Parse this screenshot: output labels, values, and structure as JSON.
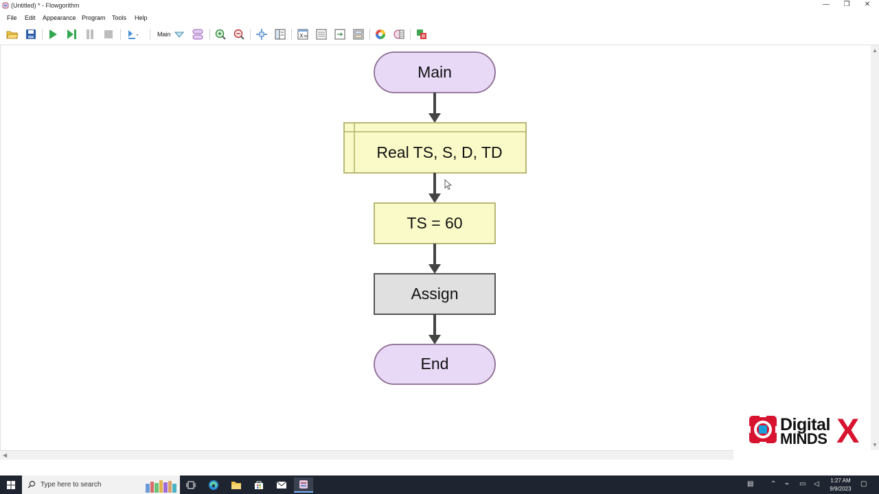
{
  "window": {
    "title": "(Untitled) * - Flowgorithm",
    "minimize_glyph": "—",
    "restore_glyph": "❐",
    "close_glyph": "✕"
  },
  "menu": {
    "items": [
      "File",
      "Edit",
      "Appearance",
      "Program",
      "Tools",
      "Help"
    ]
  },
  "toolbar": {
    "function_label": "Main",
    "icons": [
      "open-folder-icon",
      "save-icon",
      "run-icon",
      "step-icon",
      "pause-icon",
      "stop-icon",
      "run-speed-icon",
      "function-dropdown-icon",
      "manage-functions-icon",
      "zoom-in-icon",
      "zoom-out-icon",
      "layout-icon",
      "variable-watch-icon",
      "console-icon",
      "source-code-icon",
      "chart-icon",
      "color-icon",
      "style-icon",
      "language-icon"
    ]
  },
  "flowchart": {
    "start_label": "Main",
    "declare_label": "Real TS, S, D, TD",
    "assign1_label": "TS = 60",
    "assign2_label": "Assign",
    "end_label": "End",
    "colors": {
      "terminal_fill": "#e8d9f7",
      "terminal_stroke": "#8b6a8f",
      "declare_fill": "#fafac8",
      "declare_stroke": "#b0b068",
      "assign_fill": "#fafac8",
      "assign_stroke": "#b0b068",
      "placeholder_fill": "#e0e0e0",
      "placeholder_stroke": "#444444",
      "arrow": "#444444"
    }
  },
  "logo": {
    "line1": "Digital",
    "line2": "MINDS",
    "mark": "X"
  },
  "taskbar": {
    "search_placeholder": "Type here to search",
    "time": "1:27 AM",
    "date": "9/9/2023"
  }
}
